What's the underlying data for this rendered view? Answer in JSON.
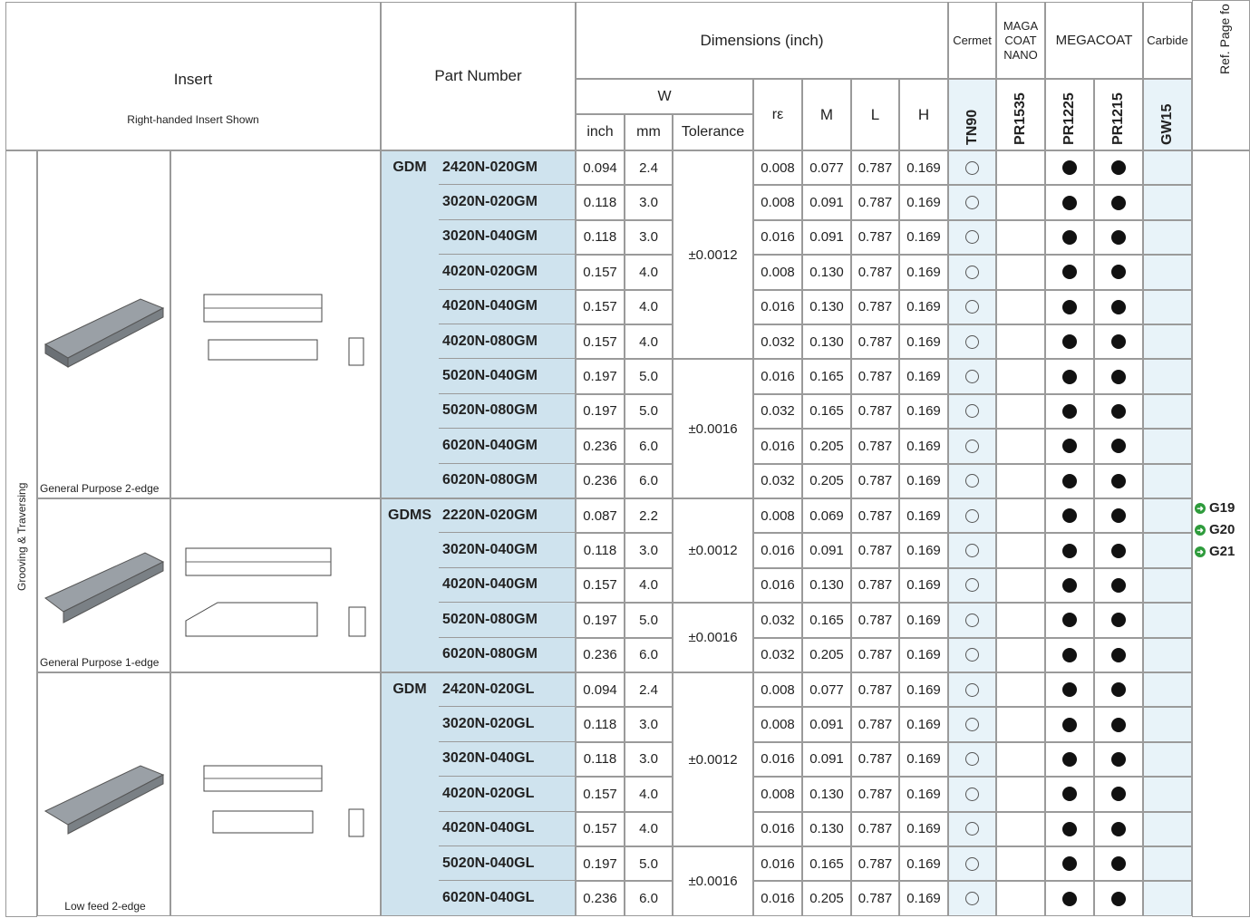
{
  "header": {
    "insert": "Insert",
    "insert_sub": "Right-handed Insert Shown",
    "part_number": "Part Number",
    "dimensions": "Dimensions (inch)",
    "w": "W",
    "inch": "inch",
    "mm": "mm",
    "tolerance": "Tolerance",
    "re": "rε",
    "m": "M",
    "l": "L",
    "h": "H",
    "cermet": "Cermet",
    "maga_line1": "MAGA",
    "maga_line2": "COAT",
    "maga_line3": "NANO",
    "megacoat": "MEGACOAT",
    "carbide": "Carbide",
    "ref_page": "Ref. Page fo",
    "grades": [
      "TN90",
      "PR1535",
      "PR1225",
      "PR1215",
      "GW15"
    ]
  },
  "category": "Grooving & Traversing",
  "groups": [
    {
      "caption": "General Purpose 2-edge",
      "prefix": "GDM"
    },
    {
      "caption": "General Purpose 1-edge",
      "prefix": "GDMS"
    },
    {
      "caption": "Low feed 2-edge",
      "prefix": "GDM"
    }
  ],
  "tolerances": [
    "±0.0012",
    "±0.0016",
    "±0.0012",
    "±0.0016",
    "±0.0012",
    "±0.0016"
  ],
  "refs": [
    "G19",
    "G20",
    "G21"
  ],
  "rows": [
    {
      "pn": "2420N-020GM",
      "inch": "0.094",
      "mm": "2.4",
      "re": "0.008",
      "m": "0.077",
      "l": "0.787",
      "h": "0.169"
    },
    {
      "pn": "3020N-020GM",
      "inch": "0.118",
      "mm": "3.0",
      "re": "0.008",
      "m": "0.091",
      "l": "0.787",
      "h": "0.169"
    },
    {
      "pn": "3020N-040GM",
      "inch": "0.118",
      "mm": "3.0",
      "re": "0.016",
      "m": "0.091",
      "l": "0.787",
      "h": "0.169"
    },
    {
      "pn": "4020N-020GM",
      "inch": "0.157",
      "mm": "4.0",
      "re": "0.008",
      "m": "0.130",
      "l": "0.787",
      "h": "0.169"
    },
    {
      "pn": "4020N-040GM",
      "inch": "0.157",
      "mm": "4.0",
      "re": "0.016",
      "m": "0.130",
      "l": "0.787",
      "h": "0.169"
    },
    {
      "pn": "4020N-080GM",
      "inch": "0.157",
      "mm": "4.0",
      "re": "0.032",
      "m": "0.130",
      "l": "0.787",
      "h": "0.169"
    },
    {
      "pn": "5020N-040GM",
      "inch": "0.197",
      "mm": "5.0",
      "re": "0.016",
      "m": "0.165",
      "l": "0.787",
      "h": "0.169"
    },
    {
      "pn": "5020N-080GM",
      "inch": "0.197",
      "mm": "5.0",
      "re": "0.032",
      "m": "0.165",
      "l": "0.787",
      "h": "0.169"
    },
    {
      "pn": "6020N-040GM",
      "inch": "0.236",
      "mm": "6.0",
      "re": "0.016",
      "m": "0.205",
      "l": "0.787",
      "h": "0.169"
    },
    {
      "pn": "6020N-080GM",
      "inch": "0.236",
      "mm": "6.0",
      "re": "0.032",
      "m": "0.205",
      "l": "0.787",
      "h": "0.169"
    },
    {
      "pn": "2220N-020GM",
      "inch": "0.087",
      "mm": "2.2",
      "re": "0.008",
      "m": "0.069",
      "l": "0.787",
      "h": "0.169"
    },
    {
      "pn": "3020N-040GM",
      "inch": "0.118",
      "mm": "3.0",
      "re": "0.016",
      "m": "0.091",
      "l": "0.787",
      "h": "0.169"
    },
    {
      "pn": "4020N-040GM",
      "inch": "0.157",
      "mm": "4.0",
      "re": "0.016",
      "m": "0.130",
      "l": "0.787",
      "h": "0.169"
    },
    {
      "pn": "5020N-080GM",
      "inch": "0.197",
      "mm": "5.0",
      "re": "0.032",
      "m": "0.165",
      "l": "0.787",
      "h": "0.169"
    },
    {
      "pn": "6020N-080GM",
      "inch": "0.236",
      "mm": "6.0",
      "re": "0.032",
      "m": "0.205",
      "l": "0.787",
      "h": "0.169"
    },
    {
      "pn": "2420N-020GL",
      "inch": "0.094",
      "mm": "2.4",
      "re": "0.008",
      "m": "0.077",
      "l": "0.787",
      "h": "0.169"
    },
    {
      "pn": "3020N-020GL",
      "inch": "0.118",
      "mm": "3.0",
      "re": "0.008",
      "m": "0.091",
      "l": "0.787",
      "h": "0.169"
    },
    {
      "pn": "3020N-040GL",
      "inch": "0.118",
      "mm": "3.0",
      "re": "0.016",
      "m": "0.091",
      "l": "0.787",
      "h": "0.169"
    },
    {
      "pn": "4020N-020GL",
      "inch": "0.157",
      "mm": "4.0",
      "re": "0.008",
      "m": "0.130",
      "l": "0.787",
      "h": "0.169"
    },
    {
      "pn": "4020N-040GL",
      "inch": "0.157",
      "mm": "4.0",
      "re": "0.016",
      "m": "0.130",
      "l": "0.787",
      "h": "0.169"
    },
    {
      "pn": "5020N-040GL",
      "inch": "0.197",
      "mm": "5.0",
      "re": "0.016",
      "m": "0.165",
      "l": "0.787",
      "h": "0.169"
    },
    {
      "pn": "6020N-040GL",
      "inch": "0.236",
      "mm": "6.0",
      "re": "0.016",
      "m": "0.205",
      "l": "0.787",
      "h": "0.169"
    }
  ],
  "availability": {
    "TN90": "open-circle",
    "PR1535": "none",
    "PR1225": "filled-dot",
    "PR1215": "filled-dot",
    "GW15": "none"
  },
  "colors": {
    "part_number_bg": "#cfe3ee",
    "grade_bg": "#e8f3f9",
    "ref_arrow": "#2e9b3c"
  }
}
